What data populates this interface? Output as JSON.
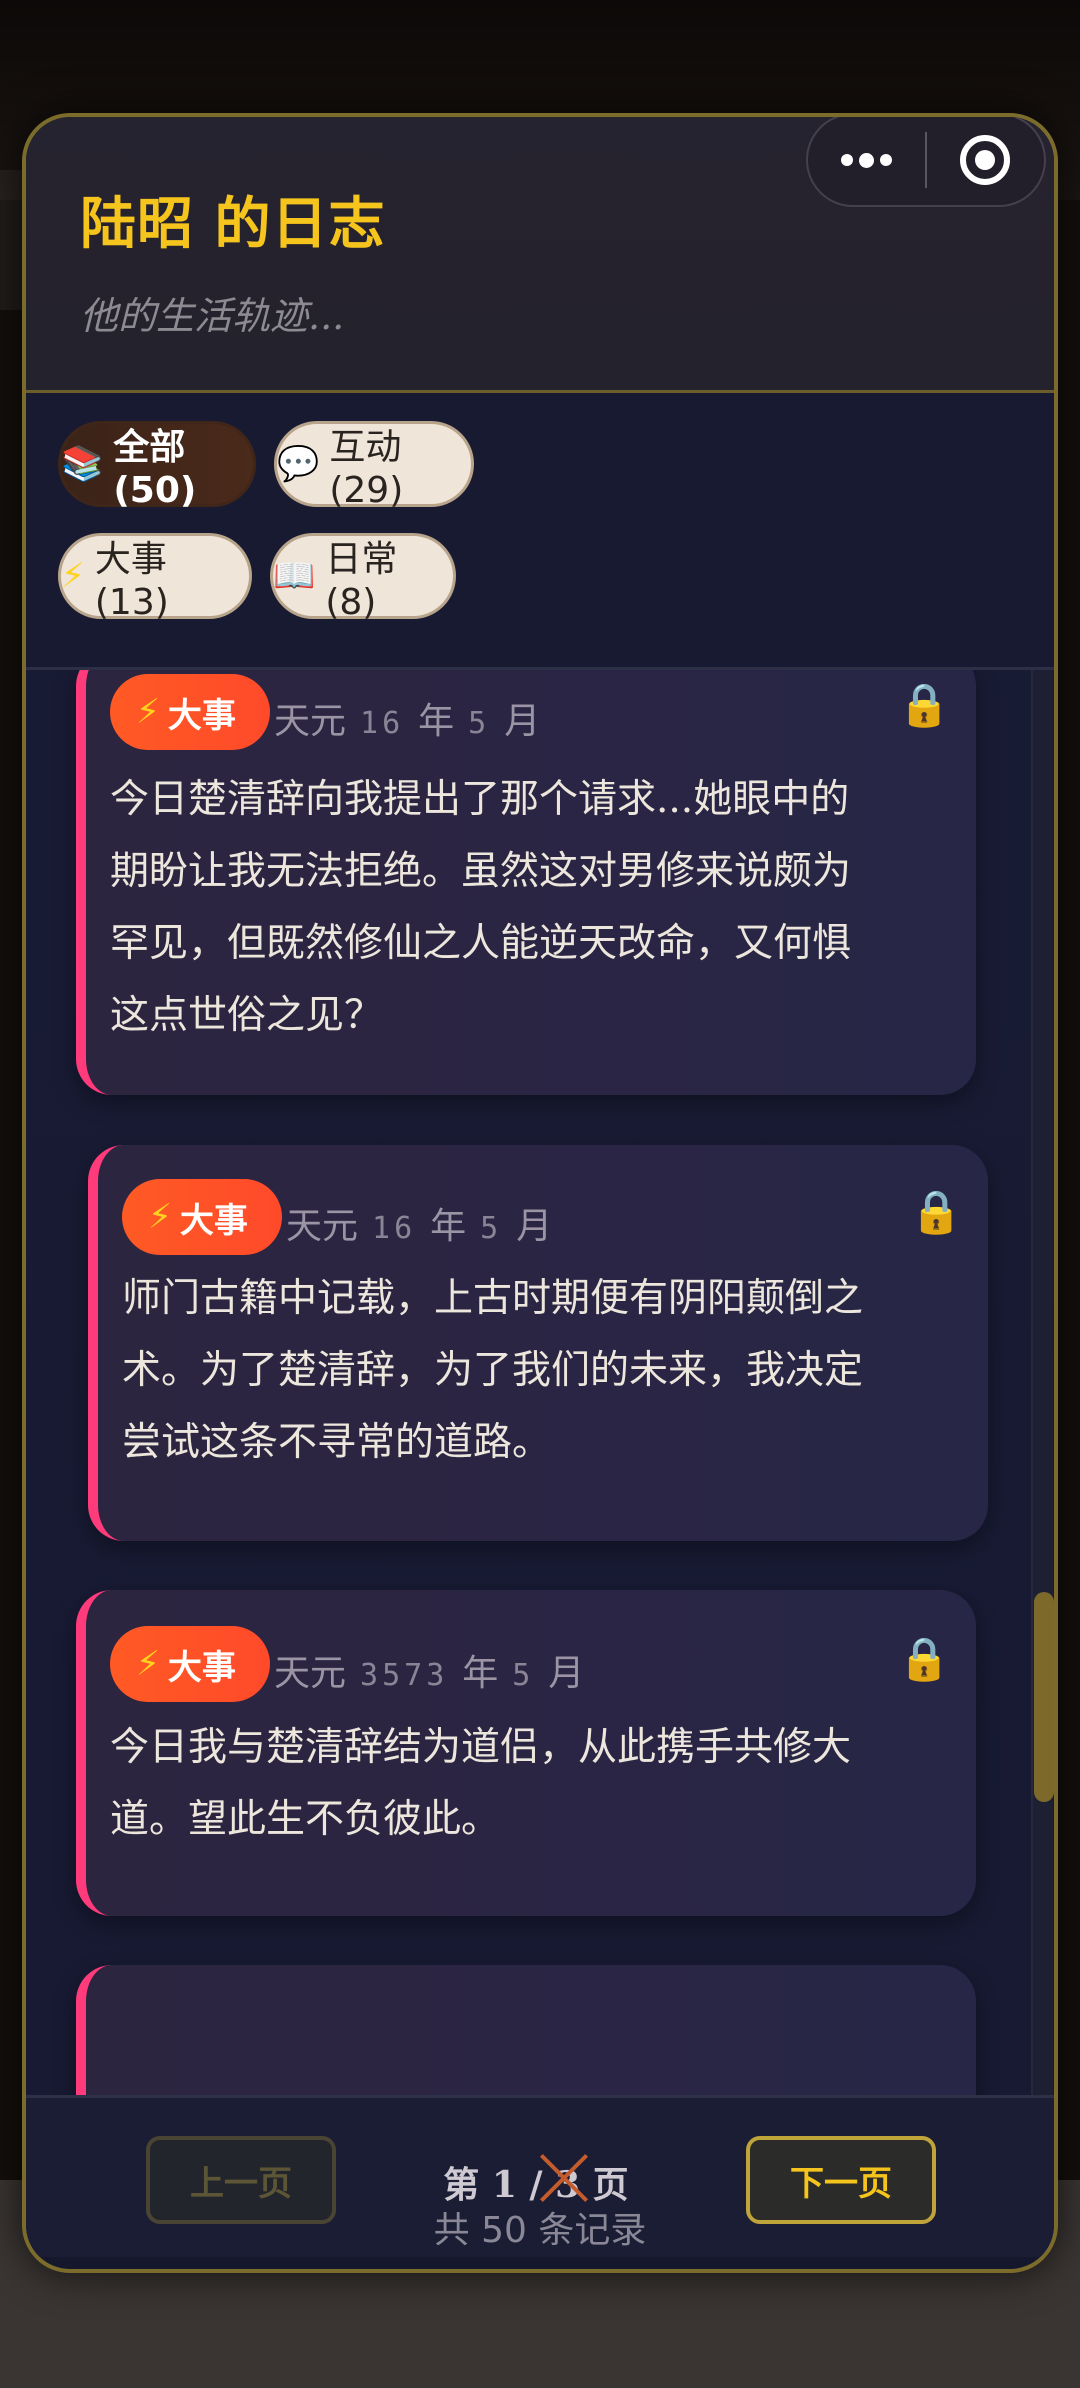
{
  "header": {
    "title": "陆昭 的日志",
    "subtitle": "他的生活轨迹..."
  },
  "capsule": {
    "more_icon": "more-dots-icon",
    "close_icon": "target-circle-icon"
  },
  "filters": [
    {
      "icon": "📚",
      "label": "全部 (50)",
      "active": true
    },
    {
      "icon": "💬",
      "label": "互动 (29)",
      "active": false
    },
    {
      "icon": "⚡",
      "label": "大事 (13)",
      "active": false
    },
    {
      "icon": "📖",
      "label": "日常 (8)",
      "active": false
    }
  ],
  "entries": [
    {
      "badge_icon": "⚡",
      "badge": "大事",
      "era": "天元",
      "year": "16",
      "year_unit": "年",
      "month": "5",
      "month_unit": "月",
      "lock_icon": "🔒",
      "text_lines": [
        "今日楚清辞向我提出了那个请求...她眼中的",
        "期盼让我无法拒绝。虽然这对男修来说颇为",
        "罕见，但既然修仙之人能逆天改命，又何惧",
        "这点世俗之见？"
      ]
    },
    {
      "badge_icon": "⚡",
      "badge": "大事",
      "era": "天元",
      "year": "16",
      "year_unit": "年",
      "month": "5",
      "month_unit": "月",
      "lock_icon": "🔒",
      "text_lines": [
        "师门古籍中记载，上古时期便有阴阳颠倒之",
        "术。为了楚清辞，为了我们的未来，我决定",
        "尝试这条不寻常的道路。"
      ]
    },
    {
      "badge_icon": "⚡",
      "badge": "大事",
      "era": "天元",
      "year": "3573",
      "year_unit": "年",
      "month": "5",
      "month_unit": "月",
      "lock_icon": "🔒",
      "text_lines": [
        "今日我与楚清辞结为道侣，从此携手共修大",
        "道。望此生不负彼此。"
      ]
    }
  ],
  "pager": {
    "prev": "上一页",
    "next": "下一页",
    "page_info": "第 1 / 3 页",
    "total": "共 50 条记录"
  },
  "colors": {
    "accent_gold": "#f6c51d",
    "badge_orange": "#ff5a24",
    "entry_bar_pink": "#ff3b7c",
    "panel_bg": "#15182d"
  }
}
